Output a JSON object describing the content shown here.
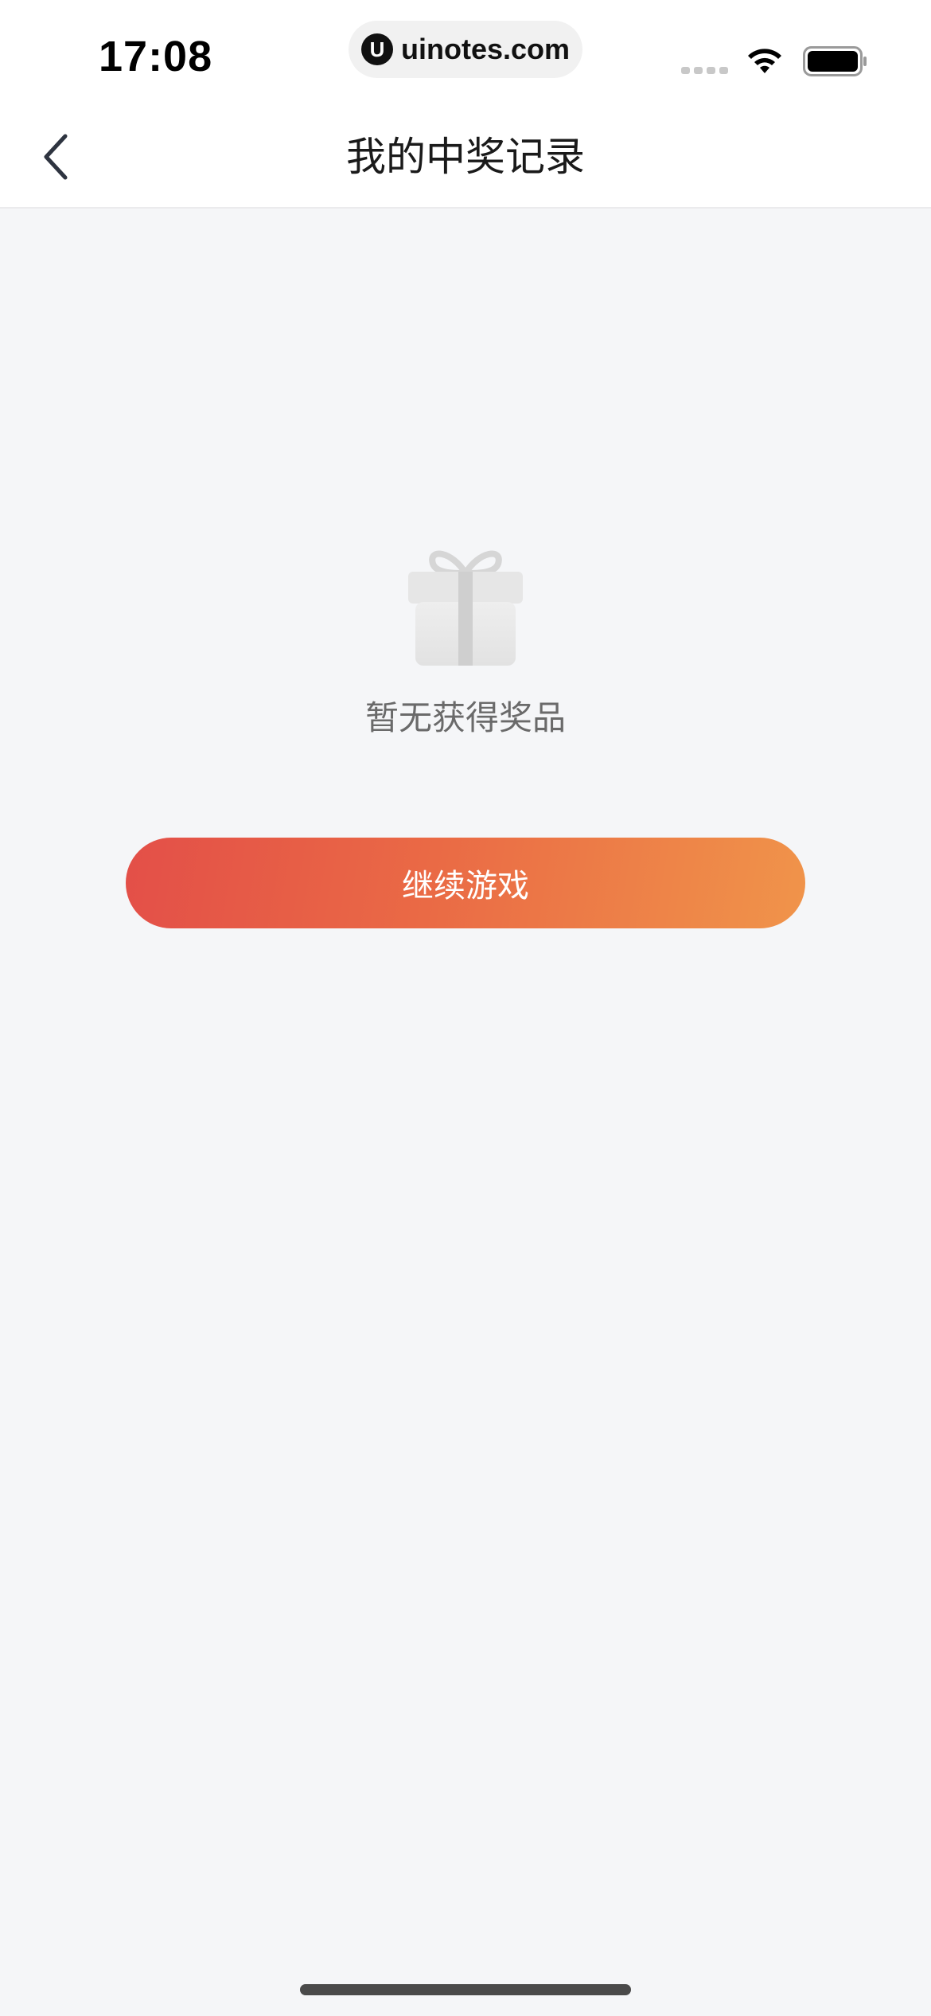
{
  "status_bar": {
    "time": "17:08",
    "url": "uinotes.com",
    "url_logo_glyph": "U",
    "icons": [
      "signal-icon",
      "wifi-icon",
      "battery-icon"
    ]
  },
  "nav": {
    "back_icon": "chevron-left-icon",
    "title": "我的中奖记录"
  },
  "empty_state": {
    "icon": "gift-icon",
    "message": "暂无获得奖品"
  },
  "actions": {
    "continue_label": "继续游戏"
  },
  "colors": {
    "background": "#f5f6f8",
    "button_gradient_start": "#e34f48",
    "button_gradient_end": "#f0944a",
    "title_text": "#1a1a1a",
    "empty_text": "#6a6a6a"
  }
}
